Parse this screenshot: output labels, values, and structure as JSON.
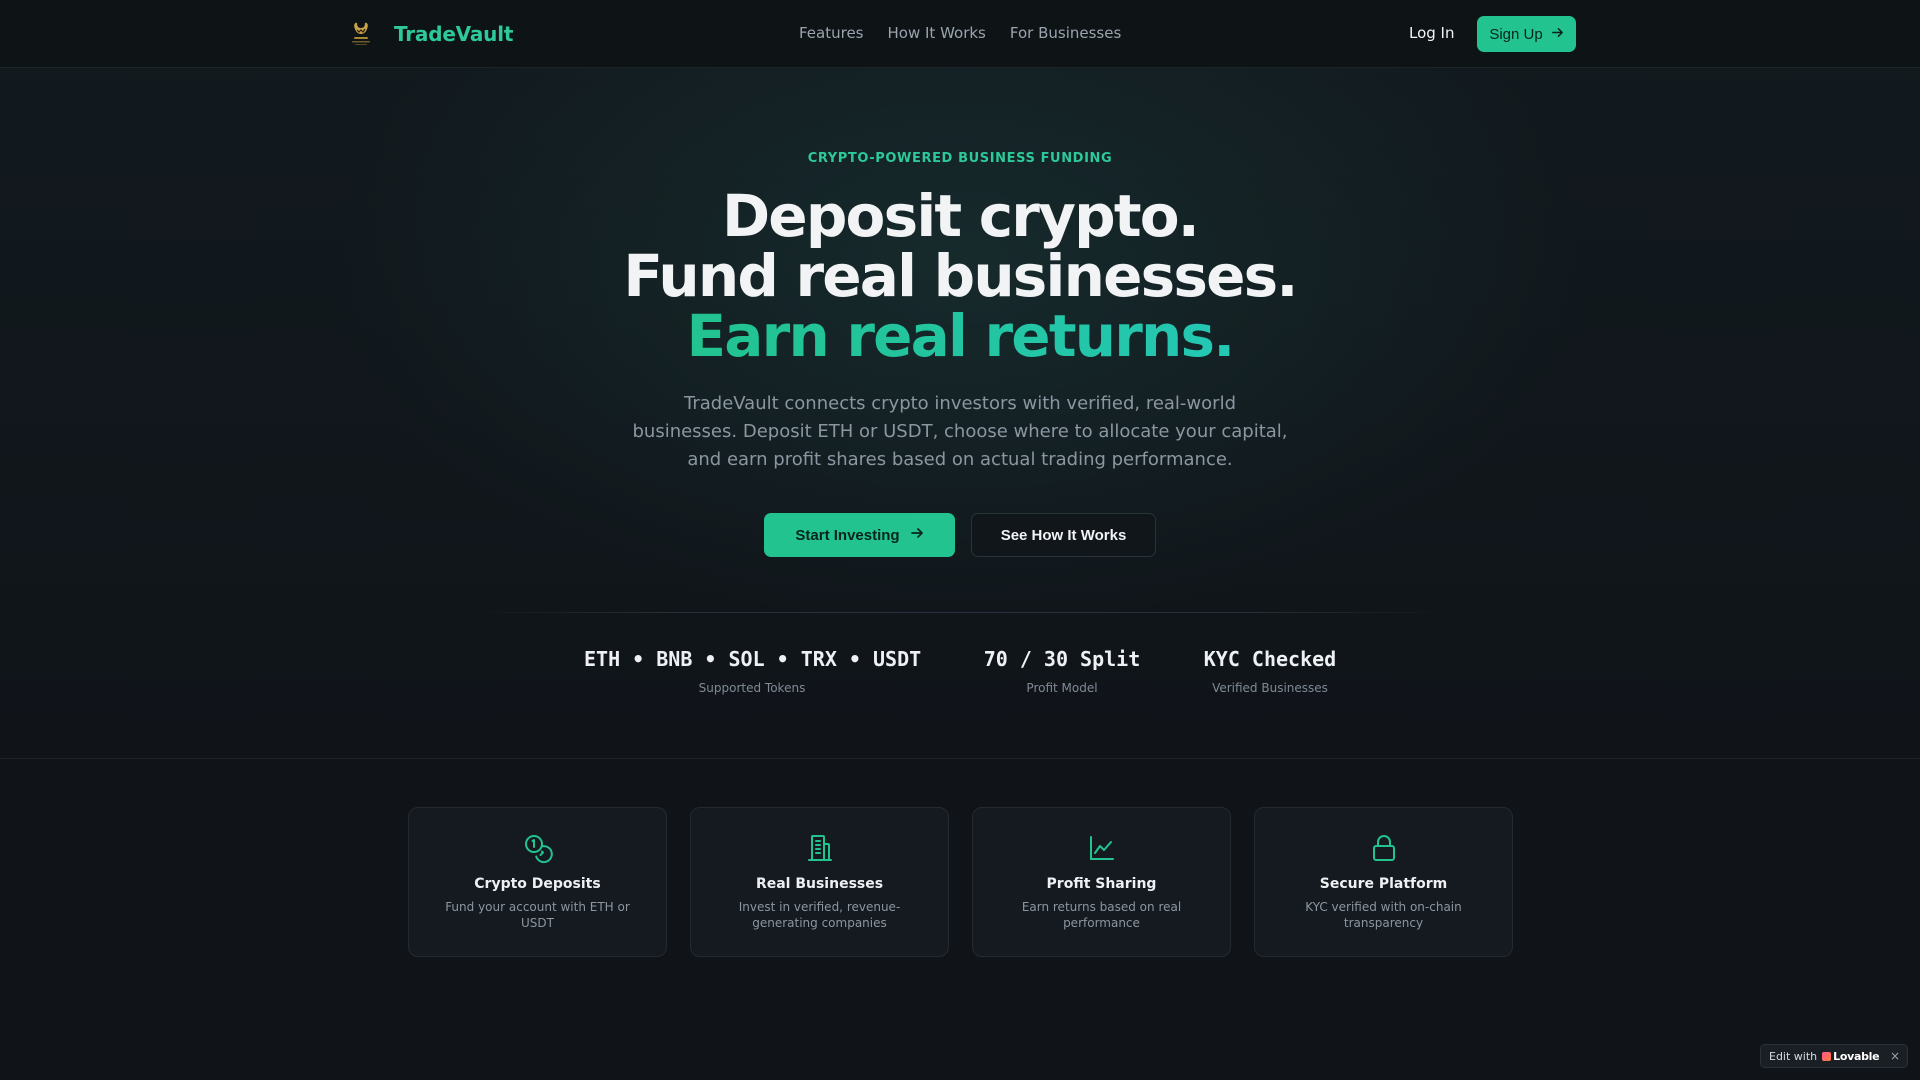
{
  "nav": {
    "brand": "TradeVault",
    "logo_icon": "trading-bull-logo-icon",
    "links": [
      "Features",
      "How It Works",
      "For Businesses"
    ],
    "login": "Log In",
    "signup": "Sign Up"
  },
  "hero": {
    "eyebrow": "CRYPTO-POWERED BUSINESS FUNDING",
    "line1": "Deposit crypto.",
    "line2": "Fund real businesses.",
    "line3": "Earn real returns.",
    "subtitle": "TradeVault connects crypto investors with verified, real-world businesses. Deposit ETH or USDT, choose where to allocate your capital, and earn profit shares based on actual trading performance.",
    "primary_cta": "Start Investing",
    "secondary_cta": "See How It Works"
  },
  "stats": [
    {
      "value": "ETH • BNB • SOL • TRX • USDT",
      "label": "Supported Tokens"
    },
    {
      "value": "70 / 30 Split",
      "label": "Profit Model"
    },
    {
      "value": "KYC Checked",
      "label": "Verified Businesses"
    }
  ],
  "features": [
    {
      "icon": "coins-icon",
      "title": "Crypto Deposits",
      "desc": "Fund your account with ETH or USDT"
    },
    {
      "icon": "building-icon",
      "title": "Real Businesses",
      "desc": "Invest in verified, revenue-generating companies"
    },
    {
      "icon": "line-chart-icon",
      "title": "Profit Sharing",
      "desc": "Earn returns based on real performance"
    },
    {
      "icon": "lock-icon",
      "title": "Secure Platform",
      "desc": "KYC verified with on-chain transparency"
    }
  ],
  "badge": {
    "prefix": "Edit with",
    "brand": "Lovable",
    "close": "×"
  },
  "colors": {
    "accent": "#22c38f",
    "accent_teal": "#24c7b3",
    "background": "#101419",
    "card": "#151a20"
  }
}
